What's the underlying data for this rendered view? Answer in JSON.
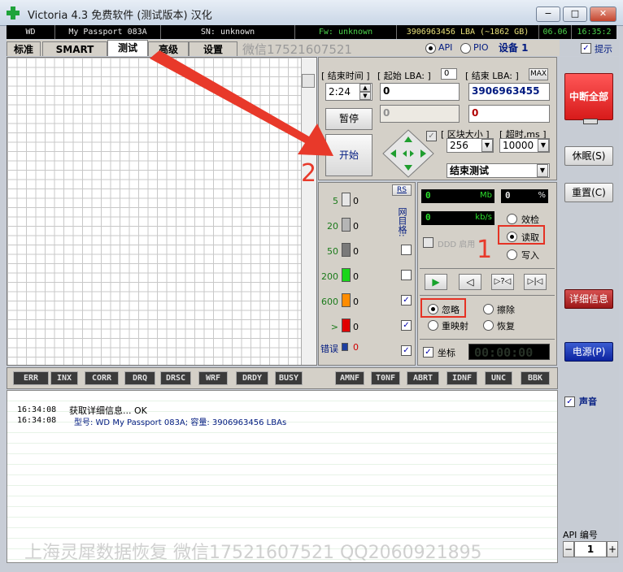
{
  "window": {
    "title": "Victoria 4.3 免费软件 (测试版本) 汉化",
    "minimize": "−",
    "maximize": "□",
    "close": "✕"
  },
  "infobar": {
    "vendor": "WD",
    "model": "My Passport 083A",
    "sn": "SN: unknown",
    "fw": "Fw: unknown",
    "lba": "3906963456 LBA (~1862 GB)",
    "date": "06.06",
    "time": "16:35:2"
  },
  "tabs": [
    "标准",
    "SMART",
    "测试",
    "高级",
    "设置"
  ],
  "wechat_tab": "微信17521607521",
  "mode": {
    "api": "API",
    "pio": "PIO",
    "device": "设备 1",
    "hint": "提示"
  },
  "test": {
    "end_time_label": "[ 结束时间 ]",
    "start_lba_label": "[ 起始 LBA: ]",
    "start_lba_small": "0",
    "end_lba_label": "[ 结束 LBA: ]",
    "max_label": "MAX",
    "time_value": "2:24",
    "start_lba": "0",
    "end_lba": "3906963455",
    "field_gray": "0",
    "field_red": "0",
    "pause": "暂停",
    "start": "开始",
    "block_label": "[ 区块大小 ]",
    "timeout_label": "[ 超时,ms ]",
    "block_value": "256",
    "timeout_value": "10000",
    "end_mode": "结束测试"
  },
  "stats": {
    "rs": "RS",
    "side_label": "网目格:",
    "rows": [
      {
        "label": "5",
        "value": "0",
        "color": "#e6e6e6",
        "checked": false
      },
      {
        "label": "20",
        "value": "0",
        "color": "#b5b5b5",
        "checked": false
      },
      {
        "label": "50",
        "value": "0",
        "color": "#7a7a7a",
        "checked": false
      },
      {
        "label": "200",
        "value": "0",
        "color": "#19d619",
        "checked": false
      },
      {
        "label": "600",
        "value": "0",
        "color": "#ff8c00",
        "checked": true
      },
      {
        "label": ">",
        "value": "0",
        "color": "#e00000",
        "checked": true
      }
    ],
    "err_label": "错误",
    "err_value": "0",
    "mb_value": "0",
    "mb_unit": "Mb",
    "pct_value": "0",
    "pct_unit": "%",
    "kbs_value": "0",
    "kbs_unit": "kb/s",
    "ddd_label": "DDD 启用",
    "verify": "效检",
    "read": "读取",
    "write": "写入",
    "ignore": "忽略",
    "erase": "擦除",
    "remap": "重映射",
    "restore": "恢复",
    "grid_label": "坐标",
    "timer": "00:00:00"
  },
  "annotations": {
    "one": "1",
    "two": "2"
  },
  "errbar": [
    "ERR",
    "INX",
    "CORR",
    "DRQ",
    "DRSC",
    "WRF",
    "DRDY",
    "BUSY",
    "AMNF",
    "T0NF",
    "ABRT",
    "IDNF",
    "UNC",
    "BBK"
  ],
  "log": [
    {
      "time": "16:34:08",
      "text": "获取详细信息... OK"
    },
    {
      "time": "16:34:08",
      "text": "型号: WD     My Passport 083A;    容量: 3906963456 LBAs"
    }
  ],
  "right": {
    "abort_all": "中断全部",
    "sleep": "休眠(S)",
    "reset": "重置(C)",
    "details": "详细信息",
    "power": "电源(P)",
    "sound": "声音",
    "api_label": "API 编号",
    "api_value": "1"
  },
  "watermark": "上海灵犀数据恢复   微信17521607521   QQ2060921895"
}
